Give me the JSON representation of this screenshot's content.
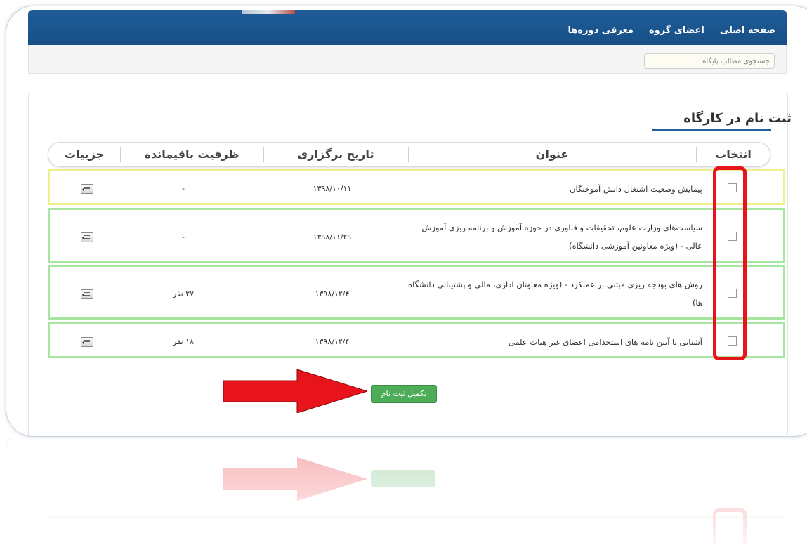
{
  "nav": {
    "items": [
      {
        "label": "صفحه اصلی"
      },
      {
        "label": "اعضای گروه"
      },
      {
        "label": "معرفی دوره‌ها"
      }
    ]
  },
  "search": {
    "placeholder": "جستجوی مطالب پایگاه"
  },
  "section": {
    "title": "ثبت نام در کارگاه"
  },
  "table": {
    "headers": {
      "select": "انتخاب",
      "title": "عنوان",
      "date": "تاریخ برگزاری",
      "capacity": "ظرفیت باقیمانده",
      "details": "جزییات"
    },
    "rows": [
      {
        "title": "پیمایش وضعیت اشتغال دانش آموختگان",
        "date": "۱۳۹۸/۱۰/۱۱",
        "capacity": "-"
      },
      {
        "title": "سیاست‌های وزارت علوم، تحقیقات و فناوری در حوزه آموزش و برنامه ریزی آموزش عالی - (ویژه معاونین آموزشی دانشگاه)",
        "date": "۱۳۹۸/۱۱/۲۹",
        "capacity": "-"
      },
      {
        "title": "روش های بودجه ریزی مبتنی بر عملکرد - (ویژه معاونان اداری، مالی و پشتیبانی دانشگاه ها)",
        "date": "۱۳۹۸/۱۲/۴",
        "capacity": "۲۷ نفر"
      },
      {
        "title": "آشنایی با آیین نامه های استخدامی اعضای غیر هیات علمی",
        "date": "۱۳۹۸/۱۲/۴",
        "capacity": "۱۸ نفر"
      }
    ]
  },
  "actions": {
    "submit_label": "تکمیل ثبت نام"
  },
  "colors": {
    "nav": "#1e5d99",
    "row_border": "#a6e6a1",
    "row_border_highlight": "#f0f08a",
    "callout_red": "#e8141c",
    "button_green": "#4dac57"
  },
  "icons": {
    "details": "details-list-icon",
    "arrow": "red-arrow-icon"
  }
}
